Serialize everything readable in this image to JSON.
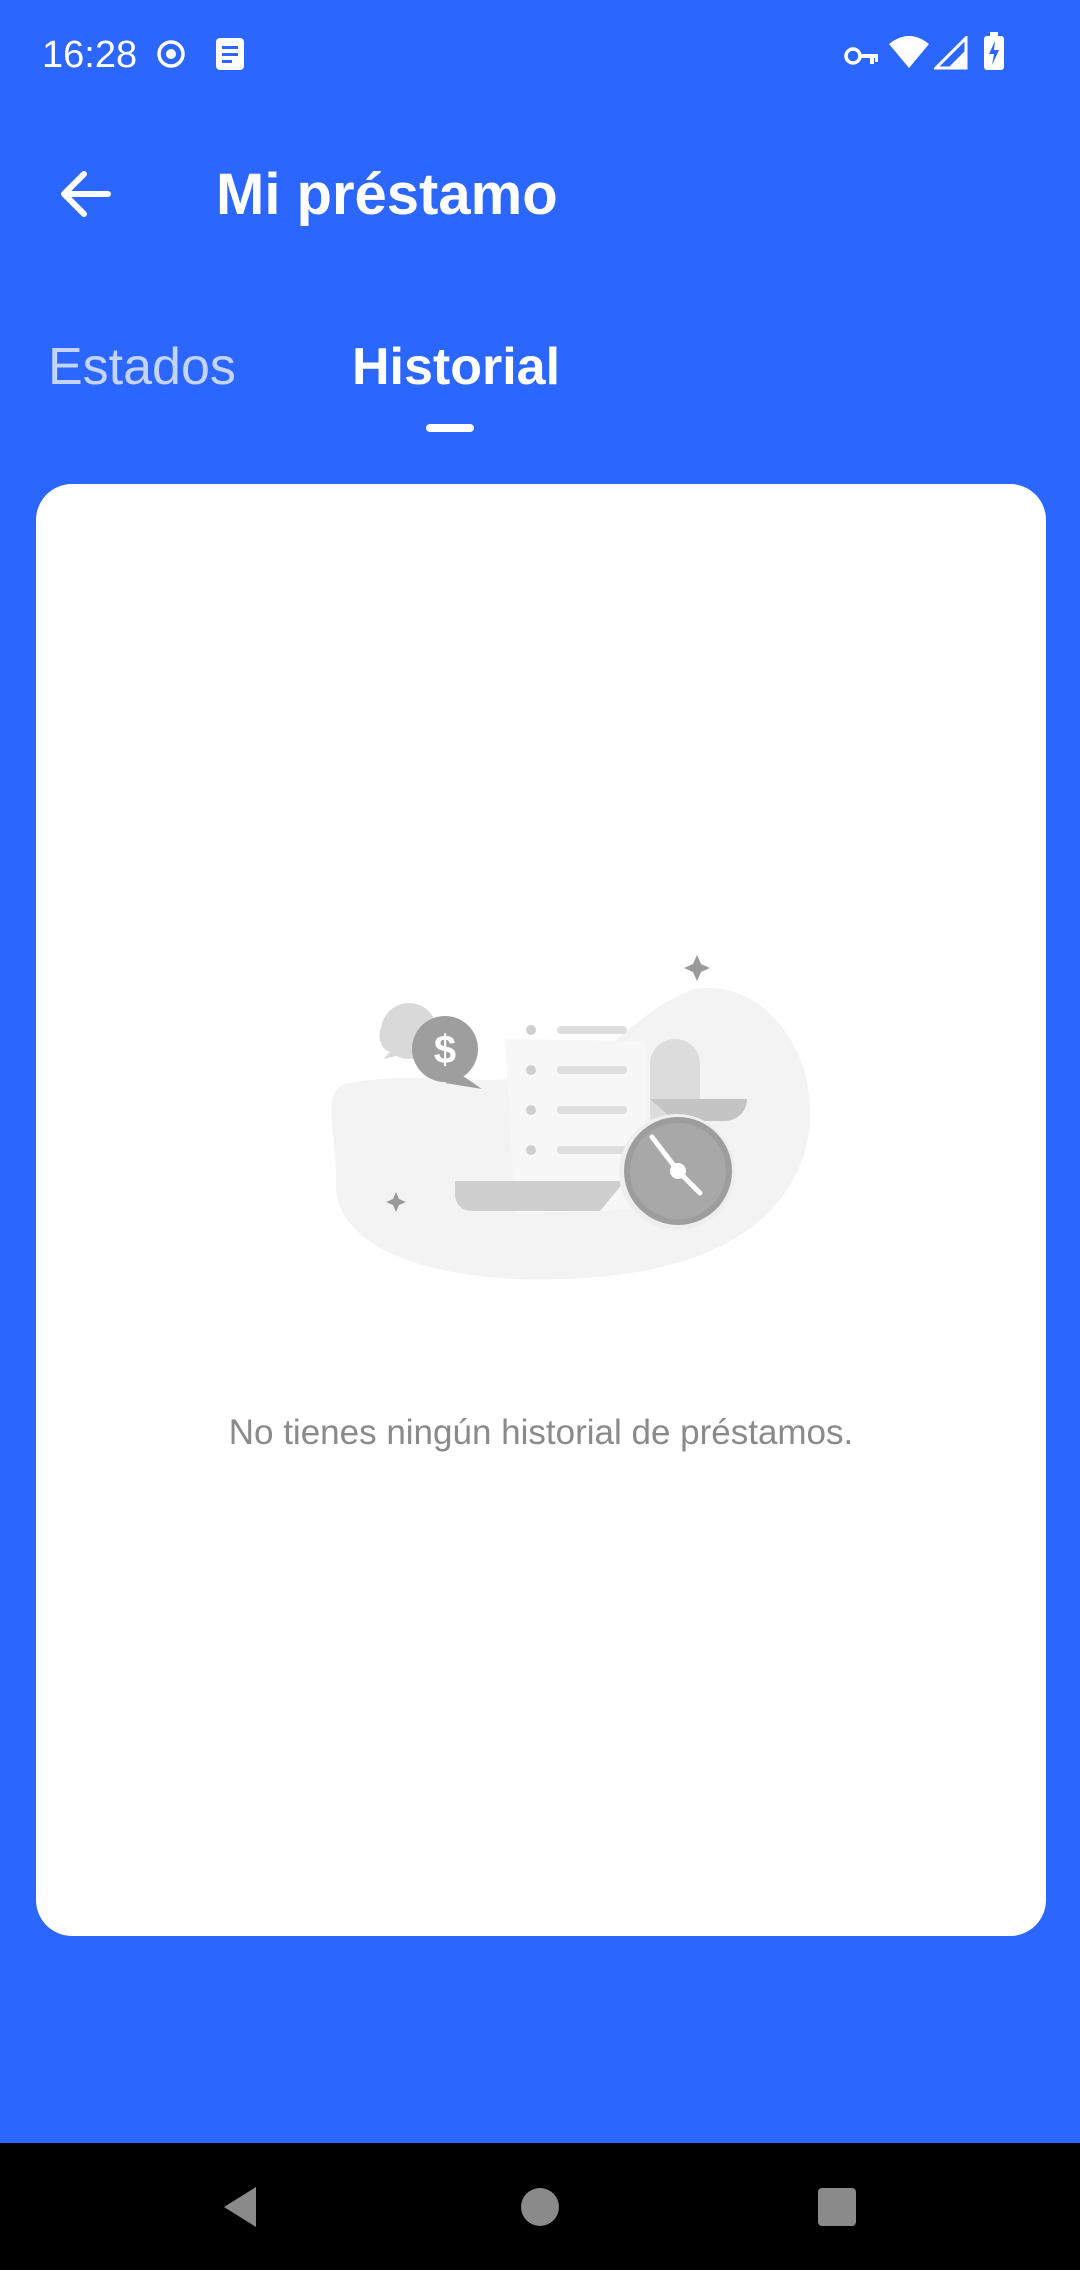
{
  "status_bar": {
    "time": "16:28",
    "icons": [
      "record-icon",
      "notes-icon",
      "vpn-key-icon",
      "wifi-icon",
      "signal-icon",
      "battery-charging-icon"
    ]
  },
  "header": {
    "title": "Mi préstamo",
    "back_icon": "arrow-left-icon"
  },
  "tabs": [
    {
      "label": "Estados",
      "active": false
    },
    {
      "label": "Historial",
      "active": true
    }
  ],
  "empty_state": {
    "illustration": "loan-history-empty-illustration",
    "message": "No tienes ningún historial de préstamos."
  },
  "nav_bar": {
    "buttons": [
      "back-triangle-icon",
      "home-circle-icon",
      "recents-square-icon"
    ]
  },
  "colors": {
    "primary": "#2b67ff",
    "card": "#ffffff",
    "muted_text": "#8a8a8a",
    "nav_bar": "#000000"
  }
}
